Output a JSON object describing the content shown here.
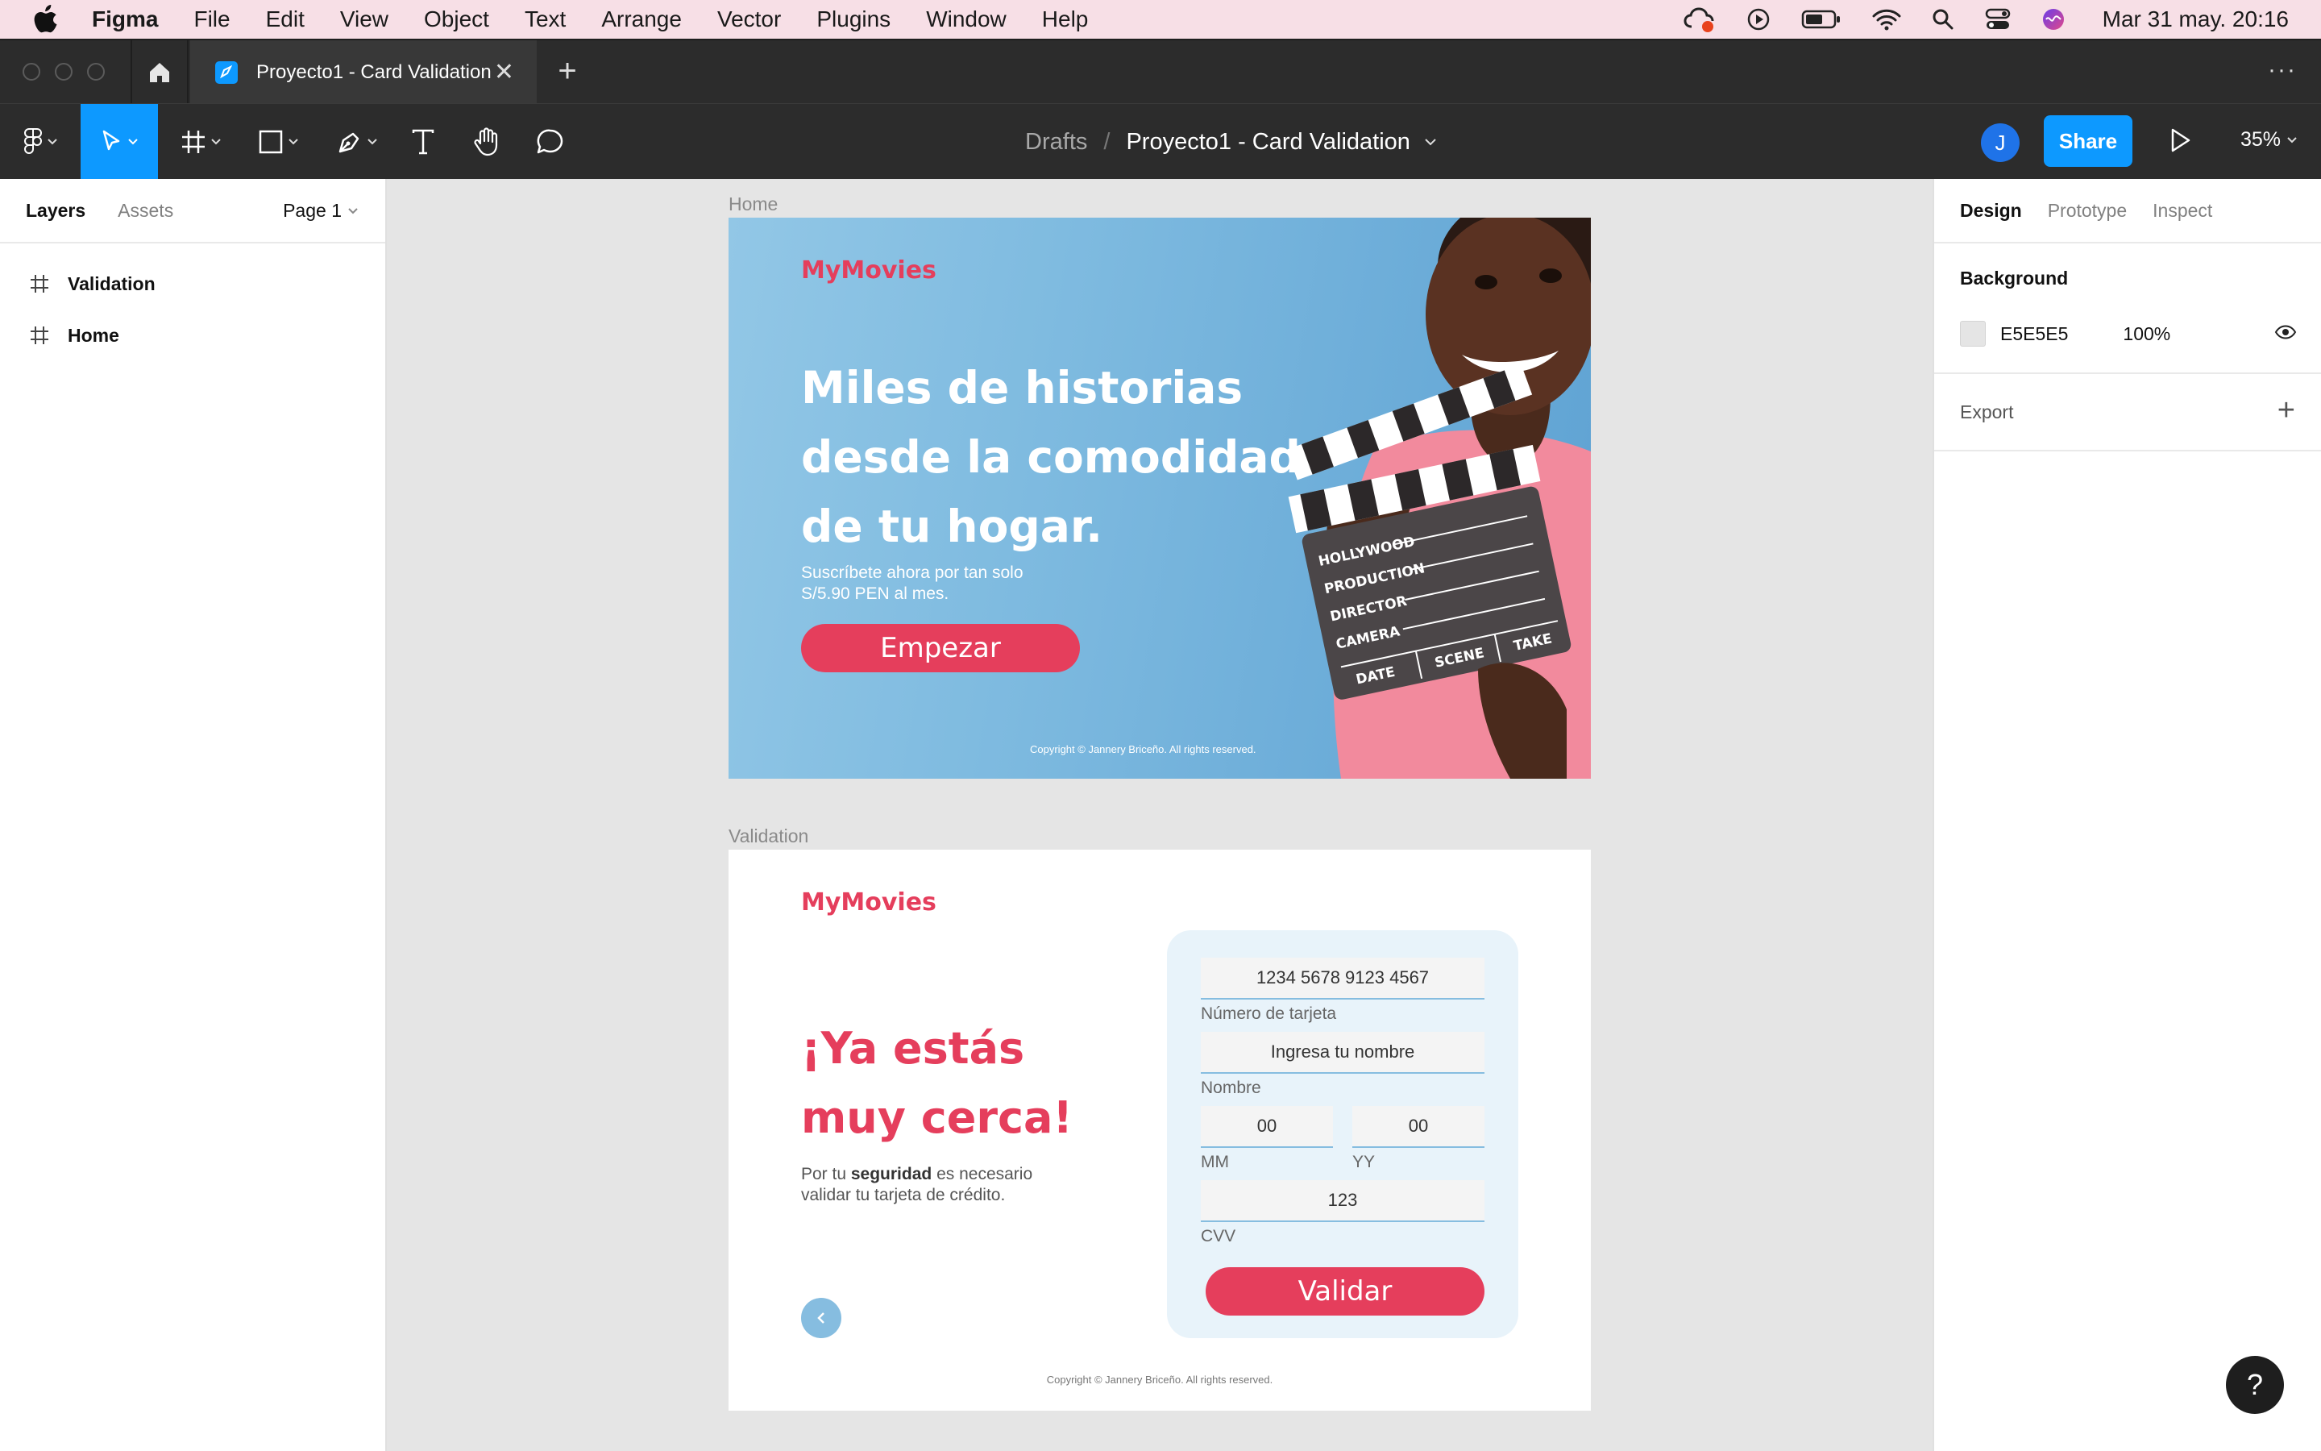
{
  "menubar": {
    "app_name": "Figma",
    "items": [
      "File",
      "Edit",
      "View",
      "Object",
      "Text",
      "Arrange",
      "Vector",
      "Plugins",
      "Window",
      "Help"
    ],
    "clock": "Mar 31 may.  20:16"
  },
  "tabbar": {
    "file_tab_title": "Proyecto1 - Card Validation",
    "close_glyph": "✕",
    "add_glyph": "+",
    "more_glyph": "···"
  },
  "toolbar": {
    "breadcrumb_root": "Drafts",
    "breadcrumb_separator": "/",
    "breadcrumb_file": "Proyecto1 - Card Validation",
    "avatar_initial": "J",
    "share_label": "Share",
    "zoom_level": "35%"
  },
  "left_panel": {
    "tabs": [
      "Layers",
      "Assets"
    ],
    "page_selector": "Page 1",
    "layers": [
      "Validation",
      "Home"
    ]
  },
  "right_panel": {
    "tabs": [
      "Design",
      "Prototype",
      "Inspect"
    ],
    "background_title": "Background",
    "background_hex": "E5E5E5",
    "background_opacity": "100%",
    "export_title": "Export",
    "export_add": "+"
  },
  "canvas": {
    "home": {
      "frame_label": "Home",
      "brand": "MyMovies",
      "hero_title": "Miles de historias desde la comodidad de tu hogar.",
      "hero_subtitle": "Suscríbete ahora por tan solo S/5.90 PEN al mes.",
      "cta_label": "Empezar",
      "copyright": "Copyright © Jannery Briceño. All rights reserved.",
      "clapper_labels": [
        "HOLLYWOOD",
        "PRODUCTION",
        "DIRECTOR",
        "CAMERA",
        "DATE",
        "SCENE",
        "TAKE"
      ]
    },
    "validation": {
      "frame_label": "Validation",
      "brand": "MyMovies",
      "title": "¡Ya estás muy cerca!",
      "text_prefix": "Por tu ",
      "text_bold": "seguridad",
      "text_suffix": " es necesario validar tu tarjeta de crédito.",
      "card_number_value": "1234 5678 9123 4567",
      "card_number_label": "Número de tarjeta",
      "name_value": "Ingresa tu nombre",
      "name_label": "Nombre",
      "month_value": "00",
      "month_label": "MM",
      "year_value": "00",
      "year_label": "YY",
      "cvv_value": "123",
      "cvv_label": "CVV",
      "validate_label": "Validar",
      "copyright": "Copyright © Jannery Briceño. All rights reserved."
    }
  },
  "help_glyph": "?",
  "colors": {
    "brand_red": "#e53e5c",
    "figma_blue": "#0d99ff",
    "canvas_bg": "#e5e5e5",
    "card_bg": "#e8f3fa",
    "accent_light_blue": "#86bde0"
  }
}
